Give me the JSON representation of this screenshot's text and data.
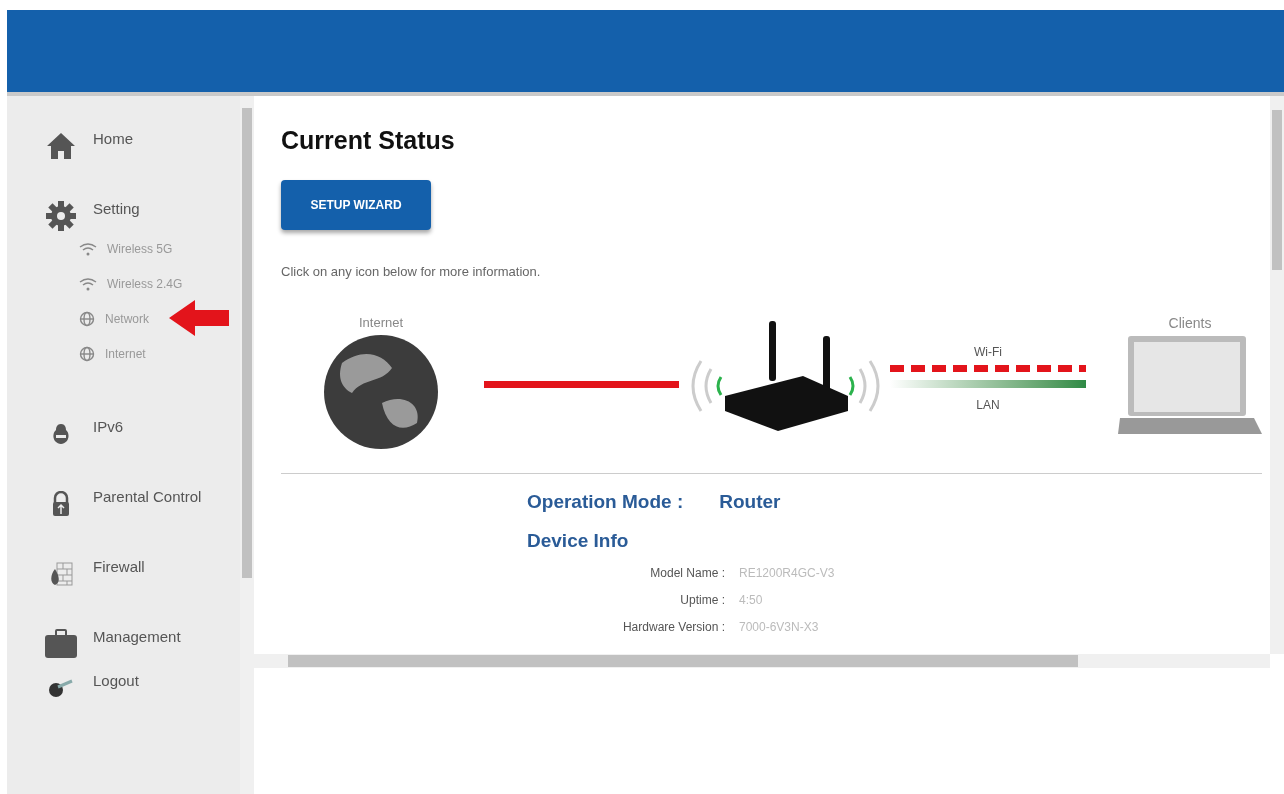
{
  "sidebar": {
    "items": [
      {
        "label": "Home",
        "kind": "home"
      },
      {
        "label": "Setting",
        "kind": "gear",
        "children": [
          {
            "label": "Wireless 5G",
            "kind": "wifi",
            "marked": false
          },
          {
            "label": "Wireless 2.4G",
            "kind": "wifi",
            "marked": false
          },
          {
            "label": "Network",
            "kind": "globe",
            "marked": true
          },
          {
            "label": "Internet",
            "kind": "globe",
            "marked": false
          }
        ]
      },
      {
        "label": "IPv6",
        "kind": "ipv6"
      },
      {
        "label": "Parental Control",
        "kind": "lock"
      },
      {
        "label": "Firewall",
        "kind": "firewall"
      },
      {
        "label": "Management",
        "kind": "briefcase"
      },
      {
        "label": "Logout",
        "kind": "logout"
      }
    ]
  },
  "content": {
    "title": "Current Status",
    "button": "SETUP WIZARD",
    "hint": "Click on any icon below for more information.",
    "diagram": {
      "internet_label": "Internet",
      "clients_label": "Clients",
      "wifi_label": "Wi-Fi",
      "lan_label": "LAN"
    },
    "operation_mode": {
      "label": "Operation Mode :",
      "value": "Router"
    },
    "device_info": {
      "title": "Device Info",
      "rows": [
        {
          "label": "Model Name :",
          "value": "RE1200R4GC-V3"
        },
        {
          "label": "Uptime :",
          "value": "4:50"
        },
        {
          "label": "Hardware Version :",
          "value": "7000-6V3N-X3"
        }
      ]
    }
  }
}
